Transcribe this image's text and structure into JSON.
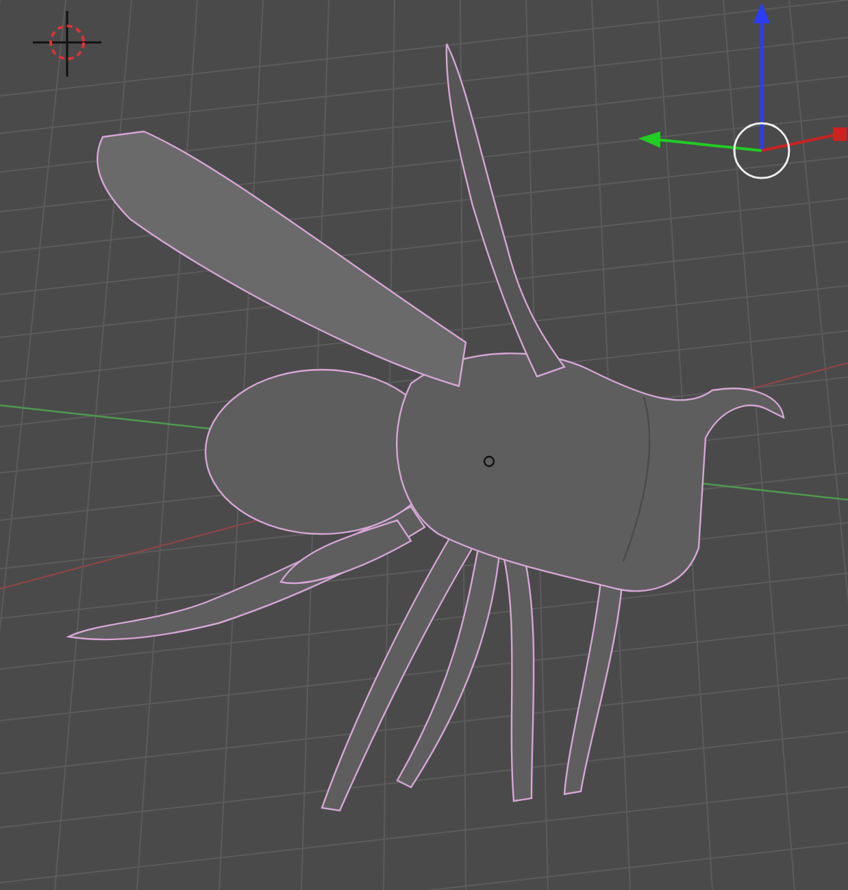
{
  "viewport": {
    "object": {
      "selected": true
    }
  }
}
